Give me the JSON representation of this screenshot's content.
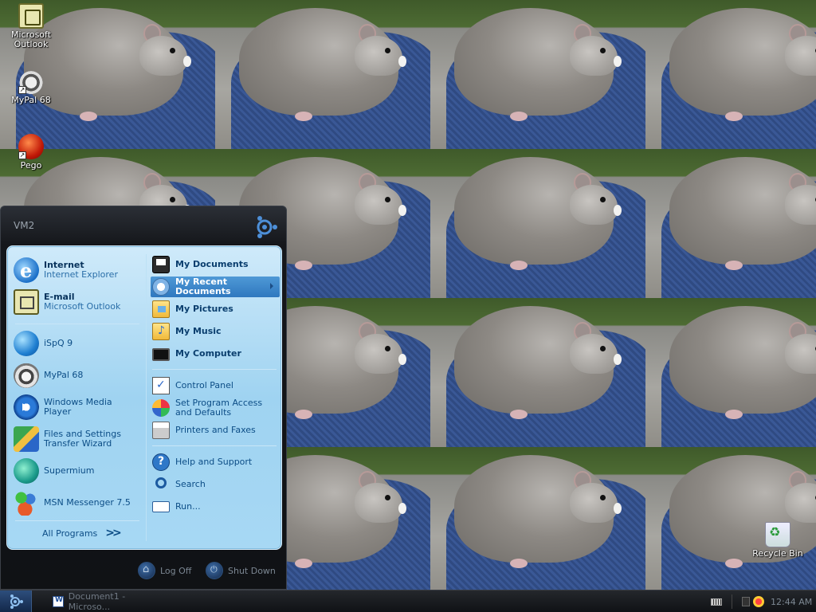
{
  "desktop": {
    "icons": [
      {
        "label_line1": "Microsoft",
        "label_line2": "Outlook",
        "icon": "outlook-icon"
      },
      {
        "label_line1": "MyPal 68",
        "label_line2": "",
        "icon": "mypal-icon"
      },
      {
        "label_line1": "Pego",
        "label_line2": "",
        "icon": "pego-icon"
      },
      {
        "label_line1": "Recycle Bin",
        "label_line2": "",
        "icon": "recycle-bin-icon"
      }
    ]
  },
  "start_menu": {
    "user_name": "VM2",
    "pinned": [
      {
        "title": "Internet",
        "subtitle": "Internet Explorer",
        "icon": "internet-explorer-icon"
      },
      {
        "title": "E-mail",
        "subtitle": "Microsoft Outlook",
        "icon": "outlook-icon"
      }
    ],
    "recent_programs": [
      {
        "line1": "iSpQ 9",
        "line2": "",
        "icon": "ispq-icon"
      },
      {
        "line1": "MyPal 68",
        "line2": "",
        "icon": "mypal-icon"
      },
      {
        "line1": "Windows Media",
        "line2": "Player",
        "icon": "media-player-icon"
      },
      {
        "line1": "Files and Settings",
        "line2": "Transfer Wizard",
        "icon": "transfer-wizard-icon"
      },
      {
        "line1": "Supermium",
        "line2": "",
        "icon": "supermium-icon"
      },
      {
        "line1": "MSN Messenger 7.5",
        "line2": "",
        "icon": "msn-messenger-icon"
      }
    ],
    "all_programs_label": "All Programs",
    "places": [
      {
        "line1": "My Documents",
        "line2": ""
      },
      {
        "line1": "My Recent",
        "line2": "Documents"
      },
      {
        "line1": "My Pictures",
        "line2": ""
      },
      {
        "line1": "My Music",
        "line2": ""
      },
      {
        "line1": "My Computer",
        "line2": ""
      }
    ],
    "system": [
      {
        "line1": "Control Panel",
        "line2": ""
      },
      {
        "line1": "Set Program Access",
        "line2": "and Defaults"
      },
      {
        "line1": "Printers and Faxes",
        "line2": ""
      }
    ],
    "support": [
      {
        "line1": "Help and Support",
        "line2": ""
      },
      {
        "line1": "Search",
        "line2": ""
      },
      {
        "line1": "Run...",
        "line2": ""
      }
    ],
    "log_off_label": "Log Off",
    "shut_down_label": "Shut Down"
  },
  "taskbar": {
    "task_label": "Document1 - Microso...",
    "clock": "12:44 AM"
  },
  "colors": {
    "menu_panel": "#a7d8f4",
    "menu_frame": "#15171b",
    "highlight": "#2f78bf",
    "taskbar": "#101215"
  }
}
